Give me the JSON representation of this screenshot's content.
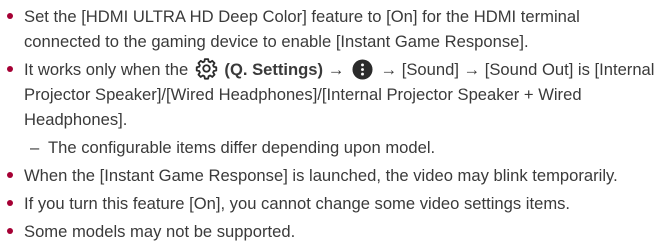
{
  "bullets": [
    {
      "text": "Set the [HDMI ULTRA HD Deep Color] feature to [On] for the HDMI terminal connected to the gaming device to enable [Instant Game Response]."
    },
    {
      "prefix": "It works only when the",
      "settings_label": "(Q. Settings)",
      "arrow1": "→",
      "arrow2": "→ [Sound] → [Sound Out] is [Internal Projector Speaker]/[Wired Headphones]/[Internal Projector Speaker + Wired Headphones].",
      "sub_dash": "–",
      "sub_note": "The configurable items differ depending upon model."
    },
    {
      "text": "When the [Instant Game Response] is launched, the video may blink temporarily."
    },
    {
      "text": "If you turn this feature [On], you cannot change some video settings items."
    },
    {
      "text": "Some models may not be supported."
    }
  ],
  "colors": {
    "bullet": "#a50034",
    "text": "#3a3a3a",
    "icon_outline": "#2b2b2b"
  },
  "icons": {
    "settings": "gear-icon",
    "more": "more-options-icon"
  }
}
